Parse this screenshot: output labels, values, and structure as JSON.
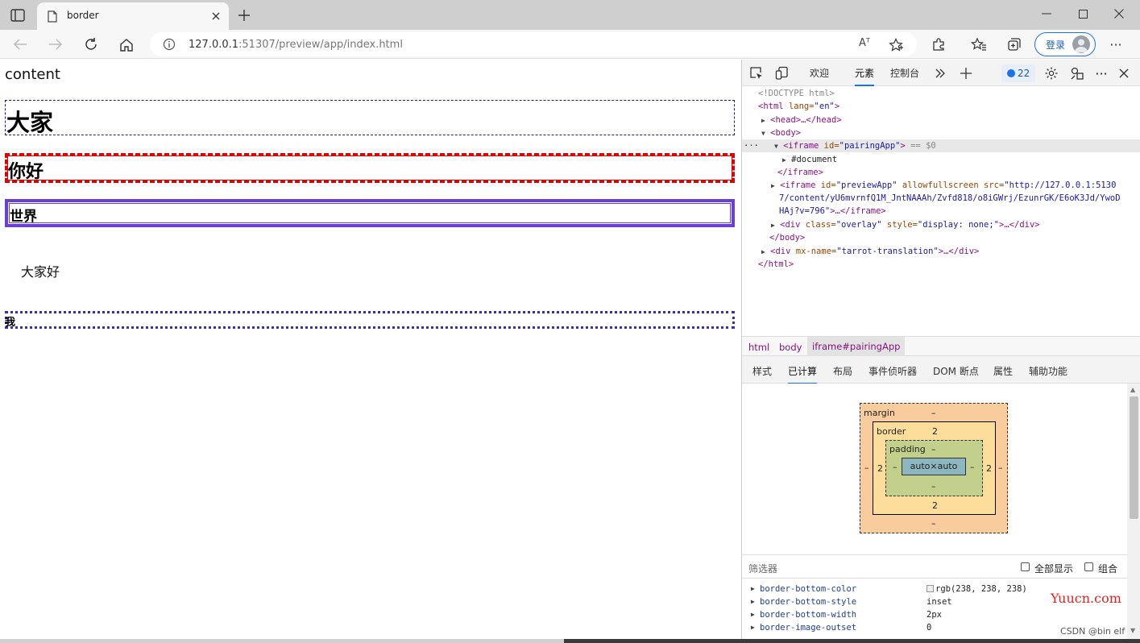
{
  "browser": {
    "tab_title": "border",
    "url_host": "127.0.0.1",
    "url_rest": ":51307/preview/app/index.html",
    "read_aloud": "Aᵀ",
    "login_label": "登录",
    "more": "···"
  },
  "page": {
    "content_text": "content",
    "h1_text": "大家",
    "h2_text": "你好",
    "h3_text": "世界",
    "p_text": "大家好",
    "small_text": "我"
  },
  "devtools": {
    "tabs": [
      "欢迎",
      "元素",
      "控制台"
    ],
    "issues_count": "22",
    "dom": {
      "doctype": "<!DOCTYPE html>",
      "html_open": "<html ",
      "lang_attr": "lang=",
      "lang_val": "\"en\"",
      "html_close_bracket": ">",
      "head": "<head>…</head>",
      "body_open": "<body>",
      "iframe1_tag": "<iframe ",
      "iframe1_attr": "id=",
      "iframe1_val": "\"pairingApp\"",
      "iframe1_end": ">",
      "iframe1_eq": " == $0",
      "document": "#document",
      "iframe_close": "</iframe>",
      "iframe2_tag": "<iframe ",
      "iframe2_id": "id=",
      "iframe2_id_val": "\"previewApp\"",
      "iframe2_allow": " allowfullscreen src=",
      "iframe2_src1": "\"http://127.0.0.1:5130",
      "iframe2_src2": "7/content/yU6mvrnfQ1M_JntNAAAh/Zvfd818/o8iGWrj/EzunrGK/E6oK3Jd/YwoD",
      "iframe2_src3": "HAj?v=796\"",
      "iframe2_end": ">…</iframe>",
      "div_tag": "<div ",
      "div_class": "class=",
      "div_class_val": "\"overlay\"",
      "div_style": " style=",
      "div_style_val": "\"display: none;\"",
      "div_end": ">…</div>",
      "body_close": "</body>",
      "div2_tag": "<div ",
      "div2_attr": "mx-name=",
      "div2_val": "\"tarrot-translation\"",
      "div2_end": ">…</div>",
      "html_close": "</html>",
      "ellipsis": "···"
    },
    "breadcrumbs": [
      "html",
      "body",
      "iframe#pairingApp"
    ],
    "subtabs": [
      "样式",
      "已计算",
      "布局",
      "事件侦听器",
      "DOM 断点",
      "属性",
      "辅助功能"
    ],
    "box_model": {
      "margin_label": "margin",
      "border_label": "border",
      "padding_label": "padding",
      "content": "auto×auto",
      "margin_top": "–",
      "margin_bottom": "–",
      "margin_left": "–",
      "margin_right": "–",
      "border_top": "2",
      "border_bottom": "2",
      "border_left": "2",
      "border_right": "2",
      "padding_top": "–",
      "padding_bottom": "–",
      "padding_left": "–",
      "padding_right": "–"
    },
    "filter_label": "筛选器",
    "show_all_label": "全部显示",
    "group_label": "组合",
    "properties": [
      {
        "name": "border-bottom-color",
        "value": "rgb(238, 238, 238)"
      },
      {
        "name": "border-bottom-style",
        "value": "inset"
      },
      {
        "name": "border-bottom-width",
        "value": "2px"
      },
      {
        "name": "border-image-outset",
        "value": "0"
      }
    ]
  },
  "watermark": {
    "site": "Yuucn.com",
    "credit": "CSDN @bin elf"
  }
}
